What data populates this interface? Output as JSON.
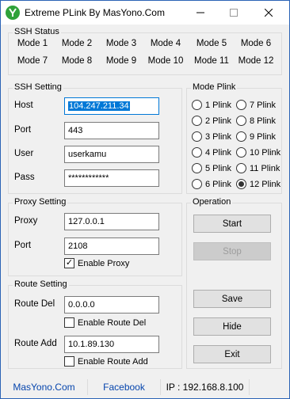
{
  "window": {
    "title": "Extreme PLink By MasYono.Com"
  },
  "ssh_status": {
    "legend": "SSH Status",
    "modes": [
      "Mode 1",
      "Mode 2",
      "Mode 3",
      "Mode 4",
      "Mode 5",
      "Mode 6",
      "Mode 7",
      "Mode 8",
      "Mode 9",
      "Mode 10",
      "Mode 11",
      "Mode 12"
    ]
  },
  "ssh_setting": {
    "legend": "SSH Setting",
    "host_label": "Host",
    "host_value": "104.247.211.34",
    "port_label": "Port",
    "port_value": "443",
    "user_label": "User",
    "user_value": "userkamu",
    "pass_label": "Pass",
    "pass_value": "************"
  },
  "mode_plink": {
    "legend": "Mode Plink",
    "options": [
      "1 Plink",
      "2 Plink",
      "3 Plink",
      "4 Plink",
      "5 Plink",
      "6 Plink",
      "7 Plink",
      "8 Plink",
      "9 Plink",
      "10 Plink",
      "11 Plink",
      "12 Plink"
    ],
    "selected": "12 Plink"
  },
  "proxy_setting": {
    "legend": "Proxy Setting",
    "proxy_label": "Proxy",
    "proxy_value": "127.0.0.1",
    "port_label": "Port",
    "port_value": "2108",
    "enable_label": "Enable Proxy",
    "enable_checked": true
  },
  "operation": {
    "legend": "Operation",
    "start": "Start",
    "stop": "Stop",
    "save": "Save",
    "hide": "Hide",
    "exit": "Exit"
  },
  "route_setting": {
    "legend": "Route Setting",
    "route_del_label": "Route Del",
    "route_del_value": "0.0.0.0",
    "enable_del_label": "Enable Route Del",
    "route_add_label": "Route Add",
    "route_add_value": "10.1.89.130",
    "enable_add_label": "Enable Route Add"
  },
  "statusbar": {
    "site": "MasYono.Com",
    "facebook": "Facebook",
    "ip": "IP : 192.168.8.100"
  }
}
